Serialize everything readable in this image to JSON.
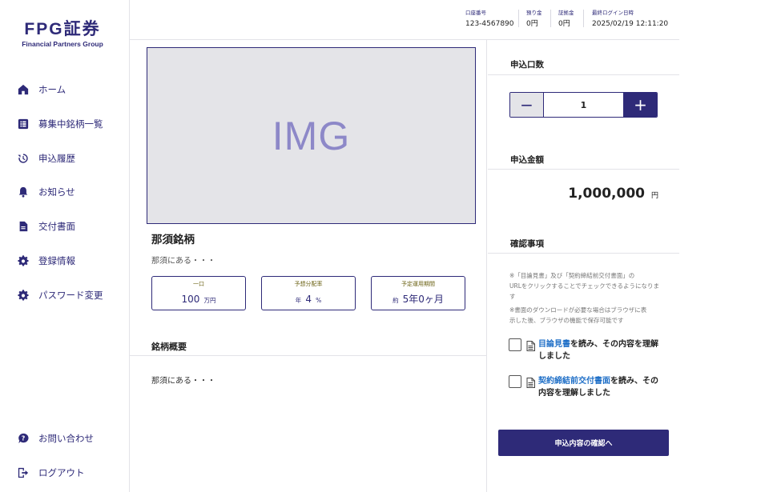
{
  "logo": {
    "main": "FPG証券",
    "sub": "Financial Partners Group"
  },
  "sidebar": {
    "items": [
      {
        "label": "ホーム",
        "icon": "home-icon"
      },
      {
        "label": "募集中銘柄一覧",
        "icon": "list-icon"
      },
      {
        "label": "申込履歴",
        "icon": "history-icon"
      },
      {
        "label": "お知らせ",
        "icon": "bell-icon"
      },
      {
        "label": "交付書面",
        "icon": "document-icon"
      },
      {
        "label": "登録情報",
        "icon": "gear-icon"
      },
      {
        "label": "パスワード変更",
        "icon": "gear-icon"
      }
    ],
    "bottom_items": [
      {
        "label": "お問い合わせ",
        "icon": "question-icon"
      },
      {
        "label": "ログアウト",
        "icon": "logout-icon"
      }
    ]
  },
  "header": {
    "account": {
      "label": "口座番号",
      "value": "123-4567890"
    },
    "deposit": {
      "label": "預り金",
      "value": "0円"
    },
    "margin": {
      "label": "証拠金",
      "value": "0円"
    },
    "last_login": {
      "label": "最終ログイン日時",
      "value": "2025/02/19 12:11:20"
    }
  },
  "product": {
    "image_placeholder": "IMG",
    "title": "那須銘柄",
    "description": "那須にある・・・",
    "info": {
      "unit": {
        "label": "一口",
        "value": "100",
        "suffix": "万円"
      },
      "yield": {
        "label": "予想分配率",
        "prefix": "年",
        "value": "4",
        "suffix": "%"
      },
      "period": {
        "label": "予定運用期間",
        "prefix": "約",
        "value": "5年0ヶ月"
      }
    },
    "summary_title": "銘柄概要",
    "summary_text": "那須にある・・・"
  },
  "order": {
    "units_title": "申込口数",
    "quantity": "1",
    "minus": "−",
    "plus": "+",
    "amount_title": "申込金額",
    "amount": "1,000,000",
    "amount_unit": "円",
    "confirm_title": "確認事項",
    "note1_line1": "※「目論見書」及び「契約締結前交付書面」の",
    "note1_line2": "URLをクリックすることでチェックできるようになります",
    "note2_line1": "※書面のダウンロードが必要な場合はブラウザに表",
    "note2_line2": "示した後、ブラウザの機能で保存可能です",
    "check1_link": "目論見書",
    "check1_text": "を読み、その内容を理解しました",
    "check2_link": "契約締結前交付書面",
    "check2_text": "を読み、その内容を理解しました",
    "confirm_button": "申込内容の確認へ"
  },
  "colors": {
    "primary": "#2e2a78",
    "link": "#1f6fc7",
    "label_gold": "#6b6214"
  }
}
